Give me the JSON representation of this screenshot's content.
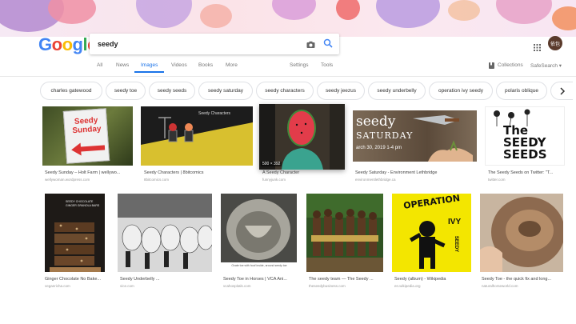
{
  "search": {
    "query": "seedy"
  },
  "account": {
    "avatar_text": "依包"
  },
  "tabs": {
    "all": "All",
    "news": "News",
    "images": "Images",
    "videos": "Videos",
    "books": "Books",
    "more": "More",
    "settings": "Settings",
    "tools": "Tools",
    "collections": "Collections",
    "safesearch": "SafeSearch ▾"
  },
  "chips": [
    "charles gatewood",
    "seedy toe",
    "seedy seeds",
    "seedy saturday",
    "seedy characters",
    "seedy jeezus",
    "seedy underbelly",
    "operation ivy seedy",
    "polaris oblique"
  ],
  "row1": [
    {
      "title": "Seedy Sunday – Holt Farm | wellywo...",
      "source": "wellywoman.wordpress.com",
      "sign_line1": "Seedy",
      "sign_line2": "Sunday"
    },
    {
      "title": "Seedy Characters | 8bitcomics",
      "source": "8bitcomics.com",
      "panel_text": "Seedy Characters"
    },
    {
      "title": "A Seedy Character",
      "source": "funnyjunk.com",
      "dims": "500 × 392"
    },
    {
      "title": "Seedy Saturday - Environment Lethbridge",
      "source": "environmentlethbridge.ca",
      "brand": "seedy",
      "brand2": "SATURDAY",
      "date": "arch 30, 2019 1-4 pm"
    },
    {
      "title": "The Seedy Seeds on Twitter: \"T...",
      "source": "twitter.com",
      "line1": "The",
      "line2": "SEEDY",
      "line3": "SEEDS"
    }
  ],
  "row2": [
    {
      "title": "Ginger Chocolate No Bake...",
      "source": "veganricha.com",
      "label": "SEEDY CHOCOLATE GINGER GRANOLA BARS"
    },
    {
      "title": "Seedy Underbelly ...",
      "source": "vice.com"
    },
    {
      "title": "Seedy Toe in Horses | VCA Ani...",
      "source": "vcahospitals.com",
      "caption_in": "Ovate toe with hoof inside, around seedy toe"
    },
    {
      "title": "The seedy team — The Seedy ...",
      "source": "theseedybusiness.com"
    },
    {
      "title": "Seedy (album) - Wikipedia",
      "source": "en.wikipedia.org",
      "cover1": "OPERATION",
      "cover2": "IVY",
      "cover3": "SEEDY"
    },
    {
      "title": "Seedy Toe - the quick fix and long...",
      "source": "naturalhorseworld.com"
    }
  ],
  "colors": {
    "accent": "#1a73e8",
    "google_blue": "#4285f4",
    "google_red": "#ea4335",
    "google_yellow": "#fbbc05",
    "google_green": "#34a853"
  }
}
